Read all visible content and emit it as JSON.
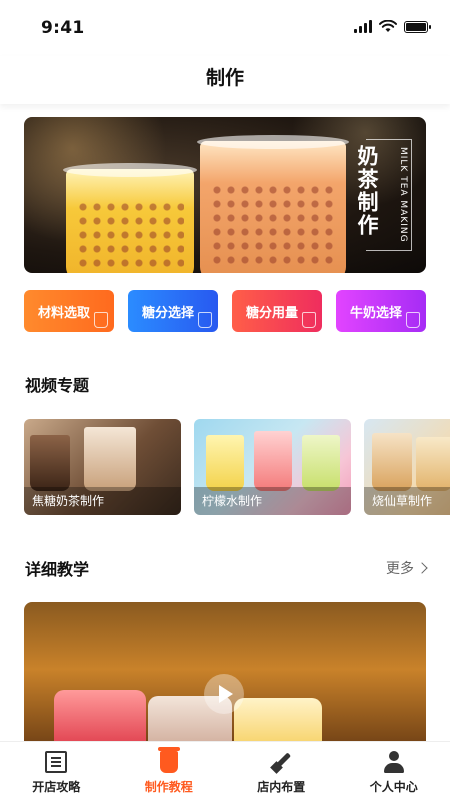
{
  "status_bar": {
    "time": "9:41"
  },
  "header": {
    "title": "制作"
  },
  "hero": {
    "title": "奶茶制作",
    "subtitle": "MILK TEA MAKING"
  },
  "quick_actions": [
    {
      "label": "材料选取"
    },
    {
      "label": "糖分选择"
    },
    {
      "label": "糖分用量"
    },
    {
      "label": "牛奶选择"
    }
  ],
  "video_section": {
    "title": "视频专题",
    "items": [
      {
        "label": "焦糖奶茶制作"
      },
      {
        "label": "柠檬水制作"
      },
      {
        "label": "烧仙草制作"
      }
    ]
  },
  "tutorial_section": {
    "title": "详细教学",
    "more_label": "更多"
  },
  "tab_bar": {
    "items": [
      {
        "label": "开店攻略",
        "icon": "book-icon"
      },
      {
        "label": "制作教程",
        "icon": "cup-icon",
        "active": true
      },
      {
        "label": "店内布置",
        "icon": "brush-icon"
      },
      {
        "label": "个人中心",
        "icon": "user-icon"
      }
    ],
    "active_color": "#ff5a1f"
  }
}
